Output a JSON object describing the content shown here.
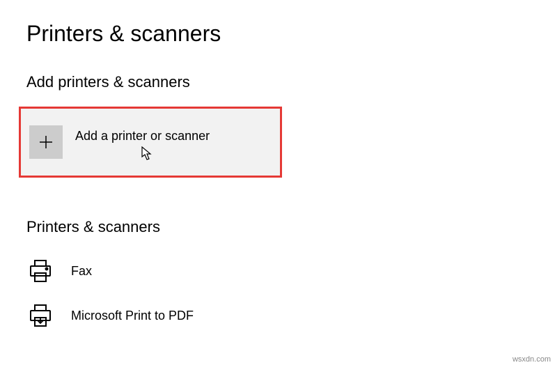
{
  "page": {
    "title": "Printers & scanners"
  },
  "add_section": {
    "header": "Add printers & scanners",
    "button_label": "Add a printer or scanner"
  },
  "list_section": {
    "header": "Printers & scanners",
    "items": [
      {
        "label": "Fax",
        "icon": "printer-icon"
      },
      {
        "label": "Microsoft Print to PDF",
        "icon": "print-to-file-icon"
      }
    ]
  },
  "watermark": "wsxdn.com"
}
